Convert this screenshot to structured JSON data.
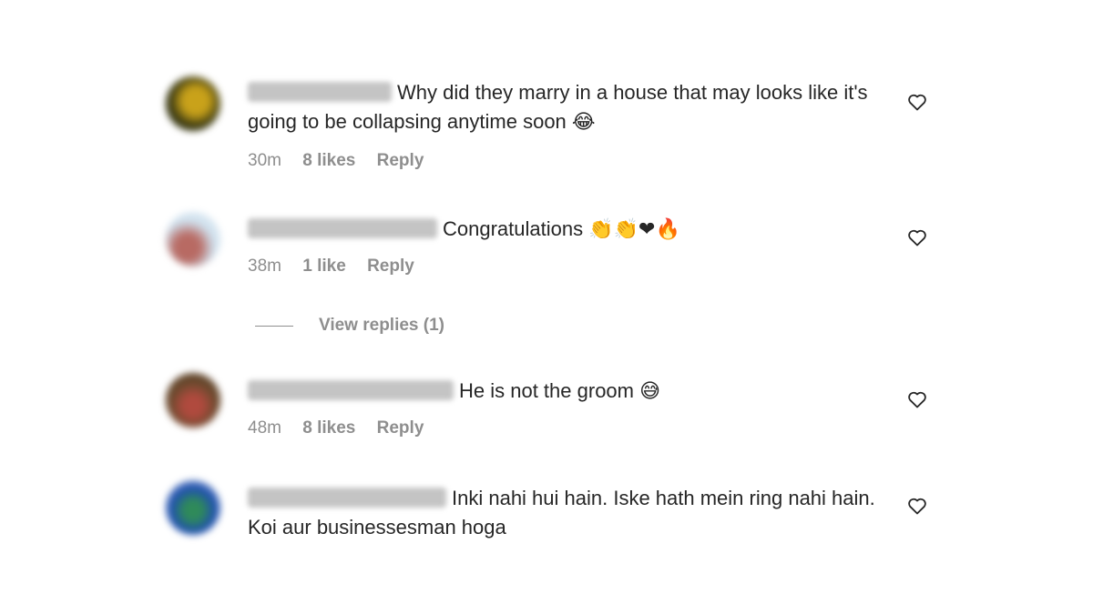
{
  "comments": [
    {
      "text": "Why did they marry in a house that may looks like it's going to be collapsing anytime soon",
      "emoji": "😂",
      "time": "30m",
      "likes": "8 likes",
      "reply": "Reply",
      "avatar_colors": [
        "#3b3a12",
        "#c9a21a"
      ]
    },
    {
      "text": "Congratulations",
      "emoji": "👏👏❤🔥",
      "time": "38m",
      "likes": "1 like",
      "reply": "Reply",
      "view_replies": "View replies (1)",
      "avatar_colors": [
        "#cfe1ee",
        "#b86a63"
      ]
    },
    {
      "text": "He is not the groom",
      "emoji": "😅",
      "time": "48m",
      "likes": "8 likes",
      "reply": "Reply",
      "avatar_colors": [
        "#6b4a2e",
        "#b04a3e"
      ]
    },
    {
      "text": "Inki nahi hui hain. Iske hath mein ring nahi hain. Koi aur businessesman hoga",
      "emoji": "",
      "avatar_colors": [
        "#1f4fb0",
        "#2f8a5a"
      ]
    }
  ],
  "icons": {
    "like": "heart-outline-icon"
  }
}
